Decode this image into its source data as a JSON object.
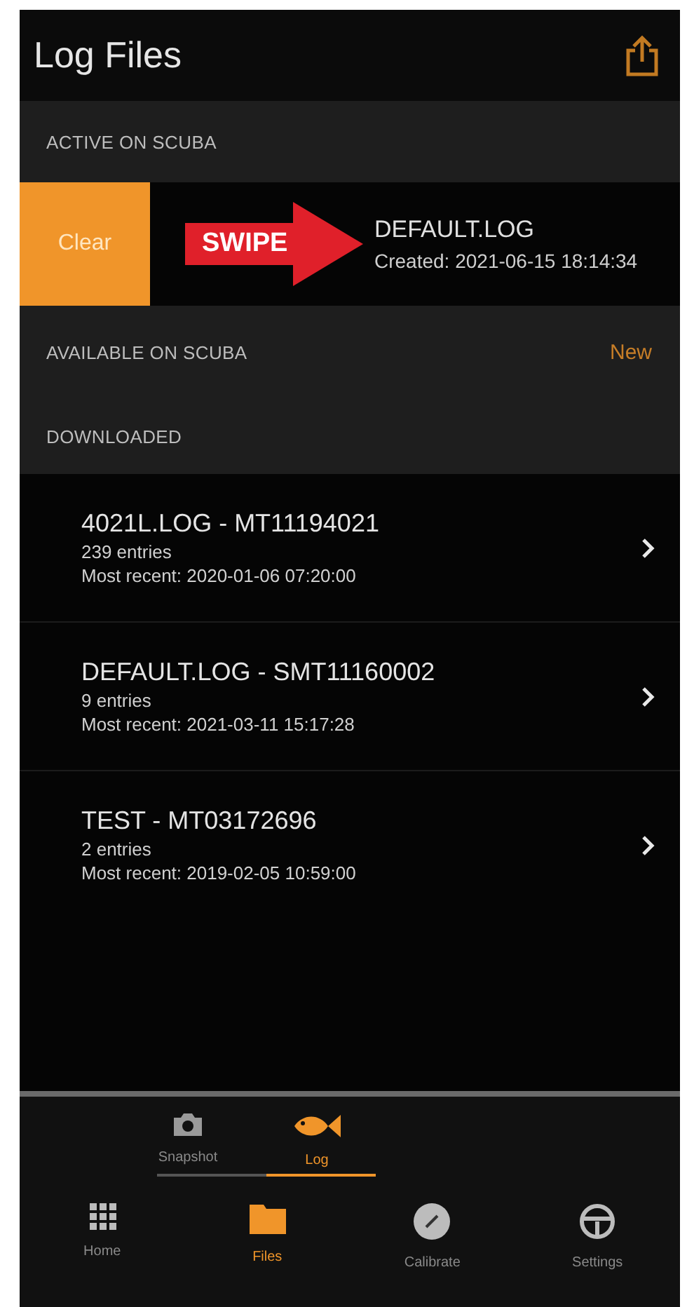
{
  "header": {
    "title": "Log Files"
  },
  "active_section": {
    "title": "ACTIVE ON SCUBA",
    "row": {
      "action": "Clear",
      "name": "DEFAULT.LOG",
      "created": "Created: 2021-06-15 18:14:34"
    },
    "annotation": "SWIPE"
  },
  "available_section": {
    "title": "AVAILABLE ON SCUBA",
    "action": "New"
  },
  "downloaded_section": {
    "title": "DOWNLOADED",
    "items": [
      {
        "title": "4021L.LOG - MT11194021",
        "entries": "239 entries",
        "recent": "Most recent: 2020-01-06 07:20:00"
      },
      {
        "title": "DEFAULT.LOG - SMT11160002",
        "entries": "9 entries",
        "recent": "Most recent: 2021-03-11 15:17:28"
      },
      {
        "title": "TEST - MT03172696",
        "entries": "2 entries",
        "recent": "Most recent: 2019-02-05 10:59:00"
      }
    ]
  },
  "sub_tabs": [
    {
      "label": "Snapshot",
      "kind": "camera",
      "selected": false
    },
    {
      "label": "Log",
      "kind": "fish",
      "selected": true
    }
  ],
  "tab_bar": [
    {
      "label": "Home",
      "kind": "grid",
      "selected": false
    },
    {
      "label": "Files",
      "kind": "folder",
      "selected": true
    },
    {
      "label": "Calibrate",
      "kind": "gauge",
      "selected": false
    },
    {
      "label": "Settings",
      "kind": "wheel",
      "selected": false
    }
  ]
}
